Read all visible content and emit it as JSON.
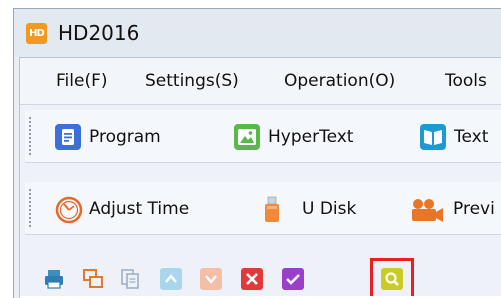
{
  "window": {
    "title": "HD2016",
    "app_icon_text": "HD"
  },
  "menu": [
    {
      "label": "File(F)"
    },
    {
      "label": "Settings(S)"
    },
    {
      "label": "Operation(O)"
    },
    {
      "label": "Tools"
    }
  ],
  "toolbar1": [
    {
      "label": "Program",
      "icon": "program-icon"
    },
    {
      "label": "HyperText",
      "icon": "hypertext-icon"
    },
    {
      "label": "Text",
      "icon": "text-book-icon"
    }
  ],
  "toolbar2": [
    {
      "label": "Adjust Time",
      "icon": "adjust-time-icon"
    },
    {
      "label": "U Disk",
      "icon": "u-disk-icon"
    },
    {
      "label": "Previ",
      "icon": "preview-camera-icon"
    }
  ],
  "small_toolbar": [
    {
      "icon": "print-icon"
    },
    {
      "icon": "duplicate-icon"
    },
    {
      "icon": "copy-page-icon"
    },
    {
      "icon": "move-up-icon"
    },
    {
      "icon": "move-down-icon"
    },
    {
      "icon": "delete-icon"
    },
    {
      "icon": "check-icon"
    },
    {
      "icon": "search-icon",
      "highlighted": true
    }
  ],
  "colors": {
    "highlight": "#e52126",
    "accent_blue": "#2f6fd6",
    "orange": "#f39a1e"
  }
}
